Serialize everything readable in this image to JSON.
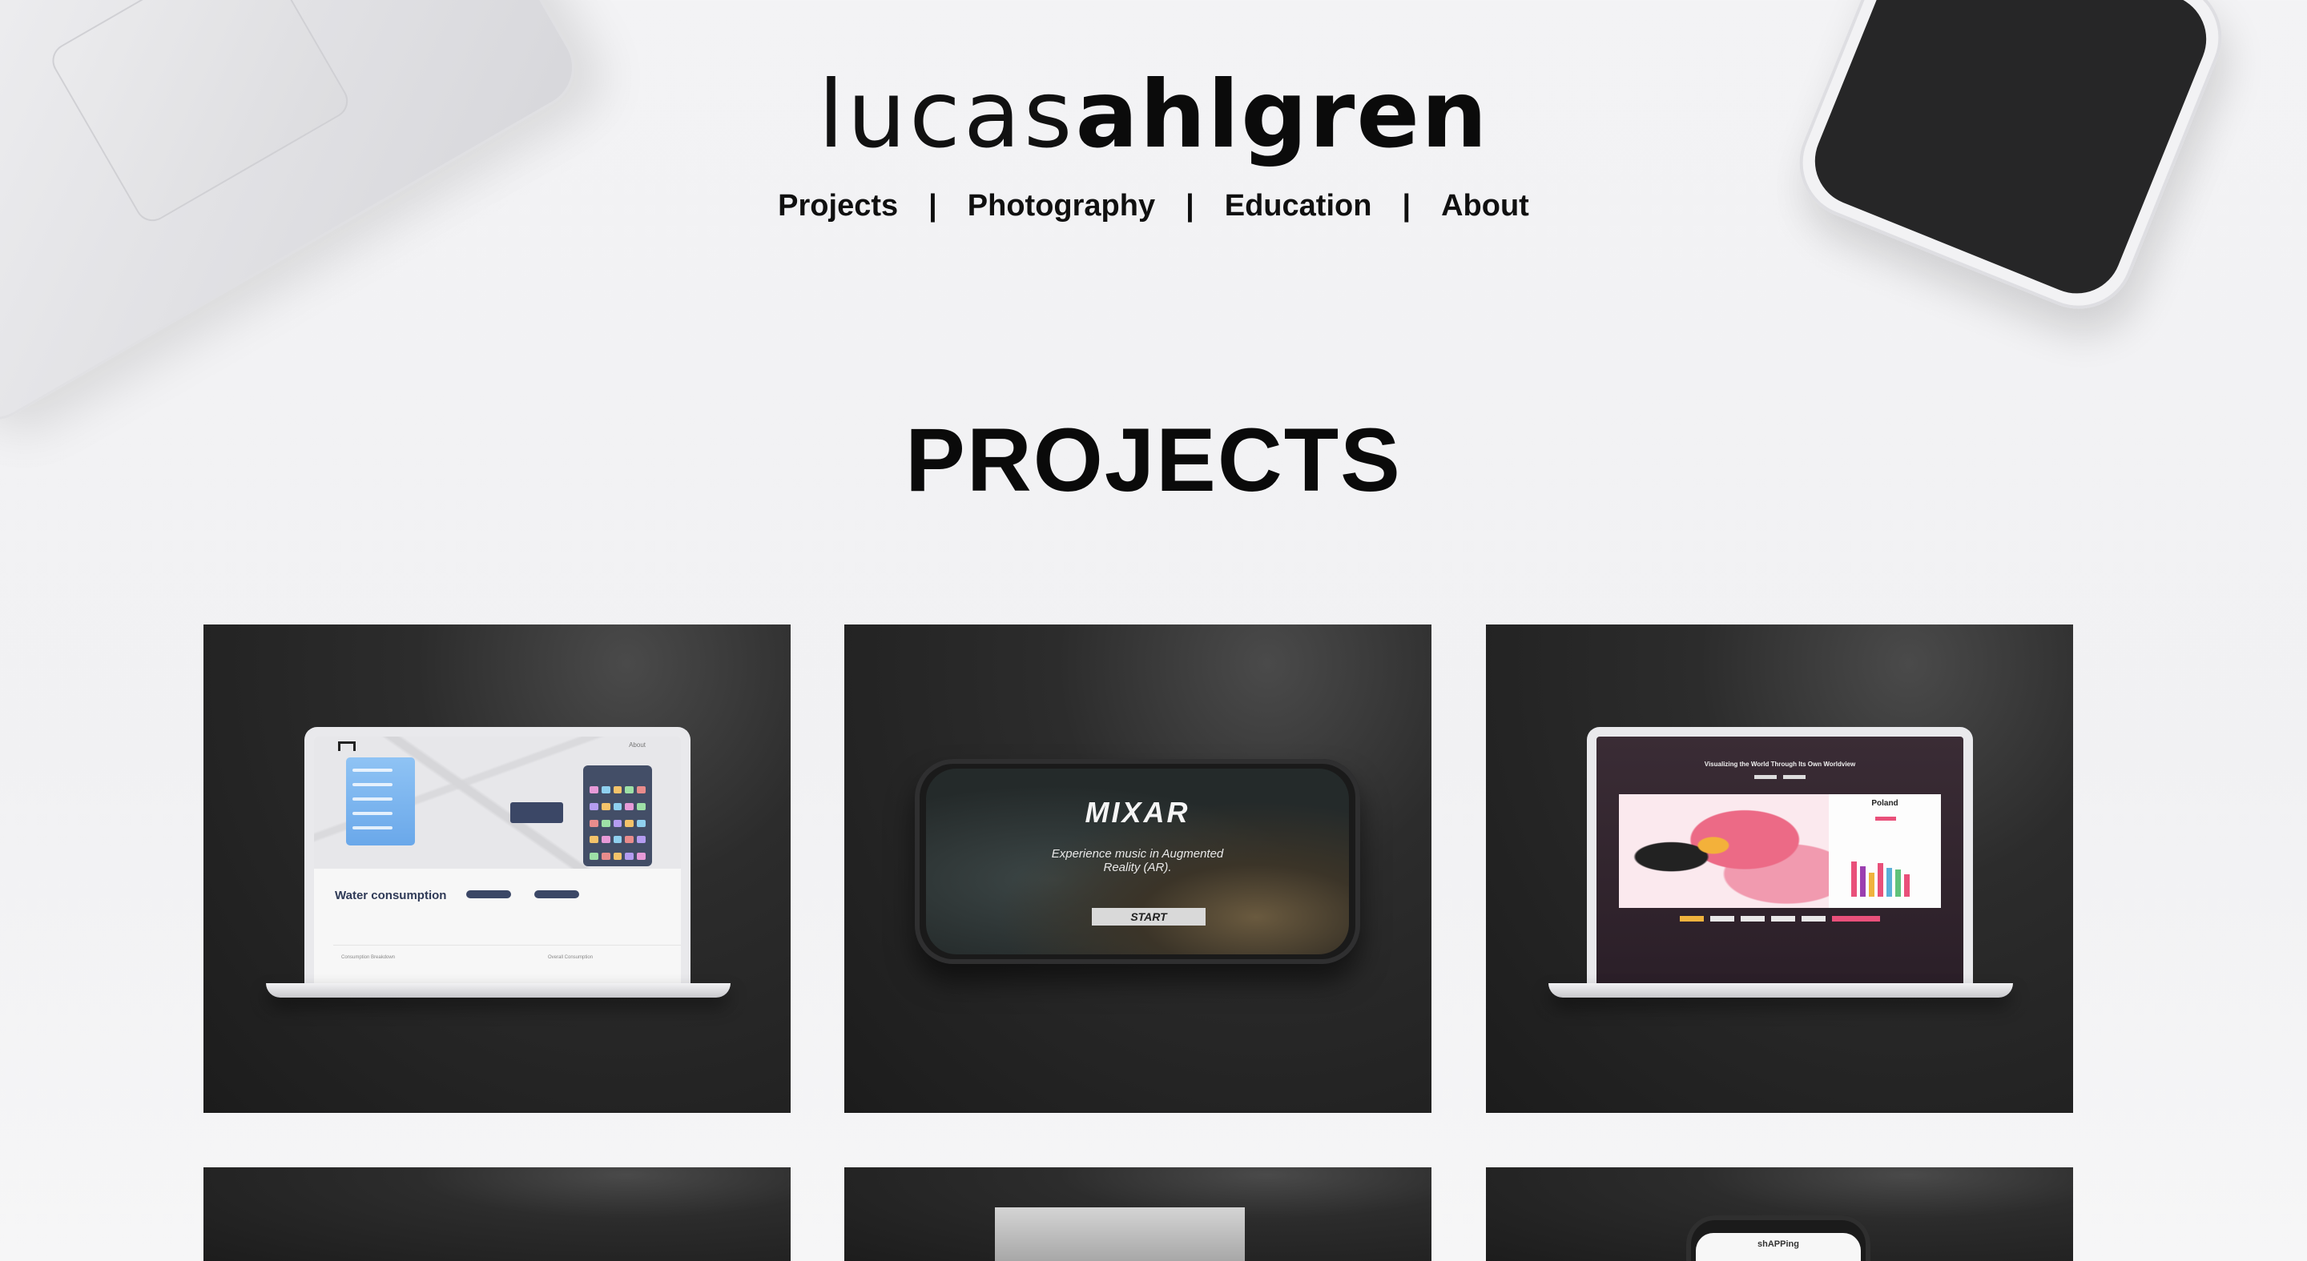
{
  "site": {
    "logo_light": "lucas",
    "logo_bold": "ahlgren"
  },
  "nav": {
    "items": [
      "Projects",
      "Photography",
      "Education",
      "About"
    ],
    "separator": "|"
  },
  "section_title": "PROJECTS",
  "projects": [
    {
      "screen": {
        "about_link": "About",
        "heading": "Water consumption",
        "row_left": "Consumption Breakdown",
        "row_right": "Overall Consumption"
      }
    },
    {
      "screen": {
        "title": "MIXAR",
        "subtitle_line1": "Experience music in Augmented",
        "subtitle_line2": "Reality (AR).",
        "button": "START"
      }
    },
    {
      "screen": {
        "title": "Visualizing the World Through Its Own Worldview",
        "country": "Poland"
      }
    },
    {
      "screen": {}
    },
    {
      "screen": {}
    },
    {
      "screen": {
        "title": "shAPPing"
      }
    }
  ],
  "colors": {
    "background": "#f2f2f4",
    "card": "#232323",
    "text": "#0e0e0e",
    "accent_pink": "#e9507a"
  }
}
